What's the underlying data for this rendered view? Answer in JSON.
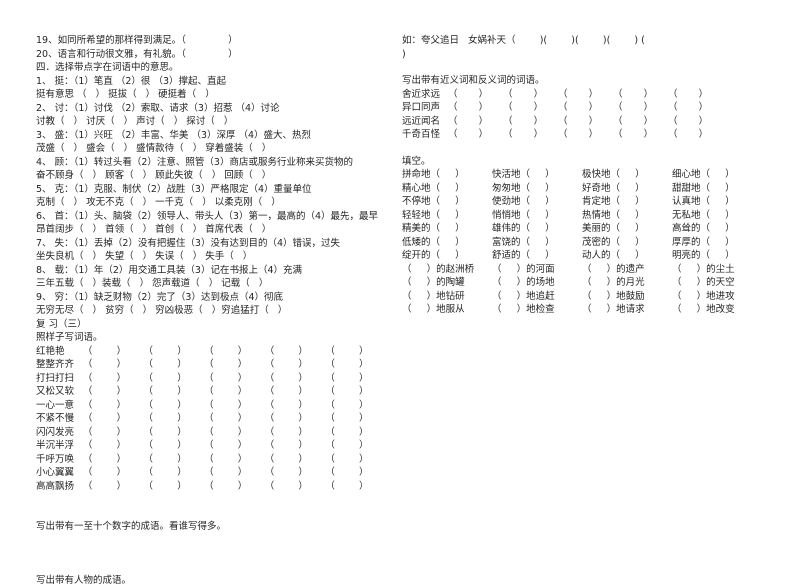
{
  "document": {
    "type": "chinese-language-worksheet",
    "page_background": "#ffffff",
    "text_color": "#242424"
  },
  "left_column": {
    "judgement_items": [
      "19、如同所希望的那样得到满足。（              ）",
      "20、语言和行动很文雅，有礼貌。（              ）"
    ],
    "section_four_heading": "四．选择带点字在词语中的意思。",
    "multiple_choice": [
      {
        "prompt": "1、 挺：（1）笔直 （2）很 （3）撑起、直起",
        "answers": "挺有意思 （   ） 挺拔（   ） 硬挺着（   ）"
      },
      {
        "prompt": "2、 讨：（1）讨伐 （2）索取、请求（3）招惹 （4）讨论",
        "answers": "讨教（   ） 讨厌（   ） 声讨（   ） 探讨（   ）"
      },
      {
        "prompt": "3、 盛：（1）兴旺 （2）丰富、华美 （3）深厚 （4）盛大、热烈",
        "answers": "茂盛（   ） 盛会（   ） 盛情款待（   ） 穿着盛装（   ）"
      },
      {
        "prompt": "4、 顾：（1）转过头看（2）注意、照管（3）商店或服务行业称来买货物的",
        "answers": "奋不顾身（   ） 顾客（   ） 顾此失彼（   ） 回顾（   ）"
      },
      {
        "prompt": "5、 克：（1）克服、制伏（2）战胜（3）严格限定（4）重量单位",
        "answers": "克制（   ） 攻无不克（   ） 一千克（   ） 以柔克刚（   ）"
      },
      {
        "prompt": "6、 首：（1）头、脑袋（2）领导人、带头人（3）第一，最高的（4）最先，最早",
        "answers": "昂首阔步（   ） 首领（   ） 首创（   ） 首席代表（   ）"
      },
      {
        "prompt": "7、 失：（1）丢掉（2）没有把握住（3）没有达到目的（4）错误，过失",
        "answers": "坐失良机（   ） 失望（   ） 失误（   ） 失手（   ）"
      },
      {
        "prompt": "8、 载：（1）年（2）用交通工具装（3）记在书报上（4）充满",
        "answers": "三年五载（   ）装载（   ） 怨声载道（   ） 记载（   ）"
      },
      {
        "prompt": "9、 穷：（1）缺乏财物（2）完了（3）达到极点（4）彻底",
        "answers": "无穷无尽（   ） 贫穷（   ） 穷凶极恶（   ）穷追猛打（   ）"
      }
    ],
    "review_title": "复 习（三）",
    "pattern_heading": "照样子写词语。",
    "pattern_rows": [
      "红艳艳 ",
      "整整齐齐",
      "打扫打扫",
      "又松又软",
      "一心一意",
      "不紧不慢",
      "闪闪发亮",
      "半沉半浮",
      "千呼万唤",
      "小心翼翼",
      "高高飘扬"
    ],
    "pattern_cell": "（        ）",
    "number_idiom_prompt": "写出带有一至十个数字的成语。看谁写得多。",
    "person_idiom_prompt": "写出带有人物的成语。"
  },
  "right_column": {
    "example_line": "如：夸父追日   女娲补天（        )(        )(        )(        ) (",
    "example_line_tail": ")",
    "synonym_heading": "写出带有近义词和反义词的词语。",
    "synonym_rows": [
      "舍近求远",
      "异口同声",
      "远近闻名",
      "千奇百怪"
    ],
    "synonym_cell": "（       ）",
    "fill_heading": "填空。",
    "adverb_rows": [
      [
        "拼命地（     ）",
        "快活地（     ）",
        "极快地（     ）",
        "细心地（     ）"
      ],
      [
        "精心地（     ）",
        "匆匆地（     ）",
        "好奇地（     ）",
        "甜甜地（     ）"
      ],
      [
        "不停地（     ）",
        "使劲地（     ）",
        "肯定地（     ）",
        "认真地（     ）"
      ],
      [
        "轻轻地（     ）",
        "悄悄地（     ）",
        "热情地（     ）",
        "无私地（     ）"
      ],
      [
        "精美的（     ）",
        "雄伟的（     ）",
        "美丽的（     ）",
        "高耸的（     ）"
      ],
      [
        "低矮的（     ）",
        "富饶的（     ）",
        "茂密的（     ）",
        "厚厚的（     ）"
      ],
      [
        "绽开的（     ）",
        "舒适的（     ）",
        "动人的（     ）",
        "明亮的（     ）"
      ]
    ],
    "modifier_rows": [
      [
        "（     ）的赵洲桥",
        "（     ）的河面",
        "（     ）的遗产",
        "（     ）的尘土"
      ],
      [
        "（     ）的陶罐",
        "（     ）的场地",
        "（     ）的月光",
        "（     ）的天空"
      ],
      [
        "（     ）地钻研",
        "（     ）地追赶",
        "（     ）地鼓励",
        "（     ）地进攻"
      ],
      [
        "（     ）地服从",
        "（     ）地检查",
        "（     ）地请求",
        "（     ）地改变"
      ]
    ]
  }
}
